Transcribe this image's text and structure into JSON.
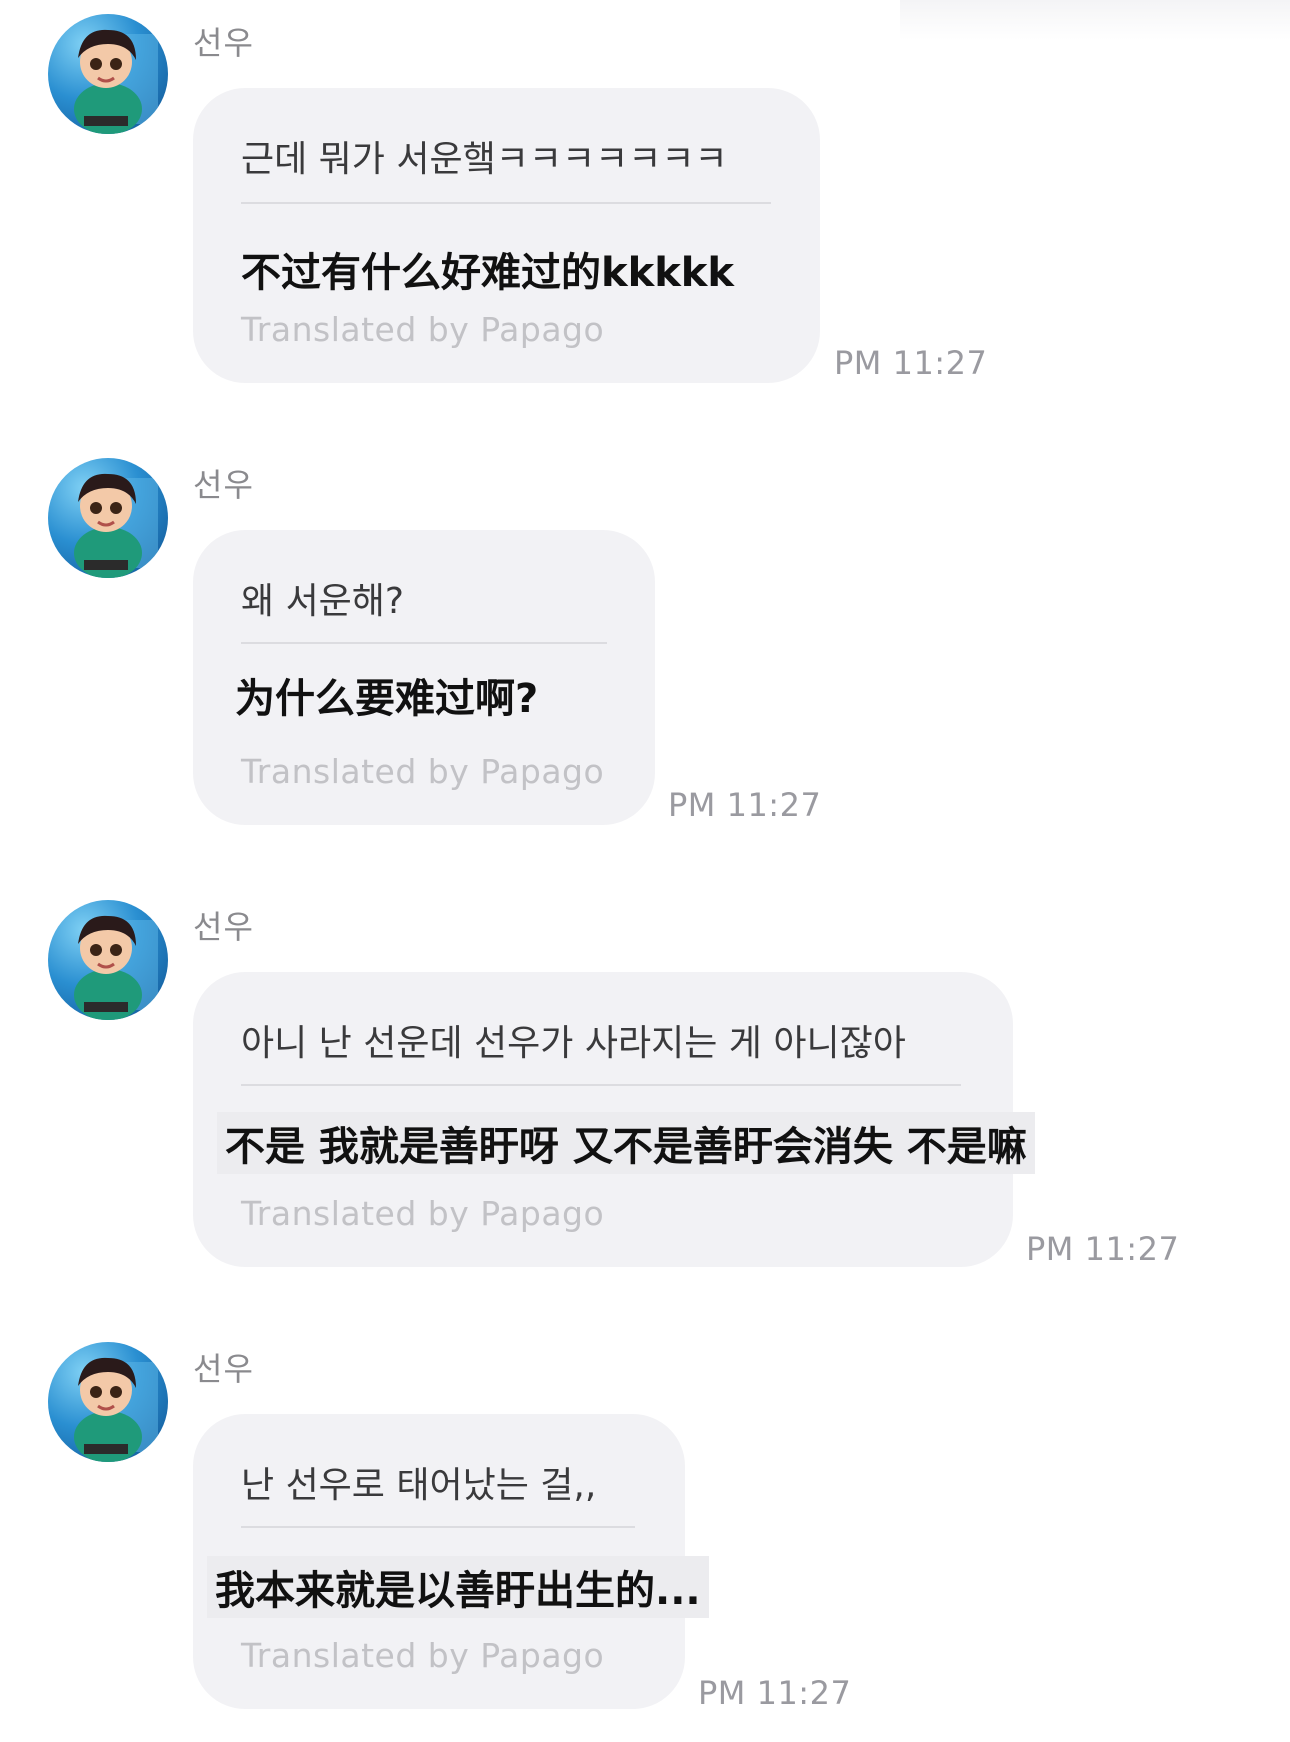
{
  "messages": [
    {
      "sender": "선우",
      "original": "근데 뭐가 서운햌ㅋㅋㅋㅋㅋㅋㅋ",
      "translated": "不过有什么好难过的kkkkk",
      "credit": "Translated by Papago",
      "time": "PM 11:27"
    },
    {
      "sender": "선우",
      "original": "왜 서운해?",
      "translated": "为什么要难过啊?",
      "credit": "Translated by Papago",
      "time": "PM 11:27"
    },
    {
      "sender": "선우",
      "original": "아니 난 선운데 선우가 사라지는 게 아니잖아",
      "translated": "不是 我就是善盱呀 又不是善盱会消失 不是嘛",
      "credit": "Translated by Papago",
      "time": "PM 11:27"
    },
    {
      "sender": "선우",
      "original": "난 선우로 태어났는 걸,,",
      "translated": "我本来就是以善盱出生的...",
      "credit": "Translated by Papago",
      "time": "PM 11:27"
    }
  ]
}
